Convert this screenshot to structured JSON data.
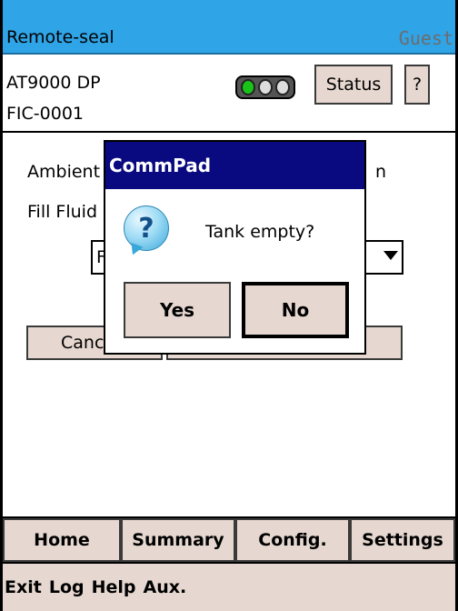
{
  "titlebar": {
    "app_name": "Remote-seal",
    "user": "Guest"
  },
  "info": {
    "device": "AT9000 DP",
    "tag": "FIC-0001",
    "traffic_light": {
      "icon": "traffic-light-icon",
      "active": "green",
      "active_color": "#17c417"
    },
    "status_label": "Status",
    "help_label": "?"
  },
  "form": {
    "ambient_label": "Ambient",
    "ambient_suffix": "n",
    "fill_label": "Fill Fluid",
    "select_value": "F",
    "cancel_label": "Canc"
  },
  "tabs": [
    {
      "label": "Home"
    },
    {
      "label": "Summary"
    },
    {
      "label": "Config."
    },
    {
      "label": "Settings"
    }
  ],
  "menu": [
    {
      "label": "Exit"
    },
    {
      "label": "Log"
    },
    {
      "label": "Help"
    },
    {
      "label": "Aux."
    }
  ],
  "dialog": {
    "title": "CommPad",
    "icon": "question-icon",
    "message": "Tank empty?",
    "yes_label": "Yes",
    "no_label": "No"
  },
  "colors": {
    "titlebar": "#2fa4e7",
    "dialog_title": "#0a0a80",
    "button_face": "#e6d8d0"
  }
}
